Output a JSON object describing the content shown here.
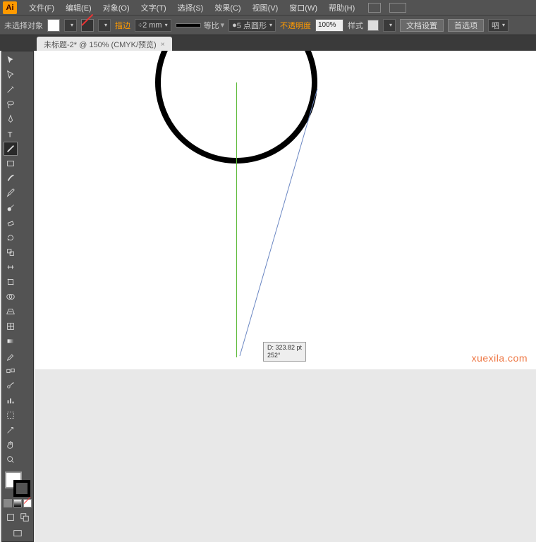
{
  "menubar": {
    "logo": "Ai",
    "items": [
      "文件(F)",
      "编辑(E)",
      "对象(O)",
      "文字(T)",
      "选择(S)",
      "效果(C)",
      "视图(V)",
      "窗口(W)",
      "帮助(H)"
    ]
  },
  "controlbar": {
    "status": "未选择对象",
    "stroke_label": "描边",
    "stroke_width": "2 mm",
    "uniform": "等比",
    "brush": "5 点圆形",
    "opacity_label": "不透明度",
    "opacity": "100%",
    "style_label": "样式",
    "doc_setup": "文档设置",
    "preferences": "首选项",
    "extra": "呬"
  },
  "tab": {
    "title": "未标题-2* @ 150% (CMYK/预览)"
  },
  "tooltip": {
    "line1": "D: 323.82 pt",
    "line2": "252°"
  },
  "watermark": "xuexila.com"
}
